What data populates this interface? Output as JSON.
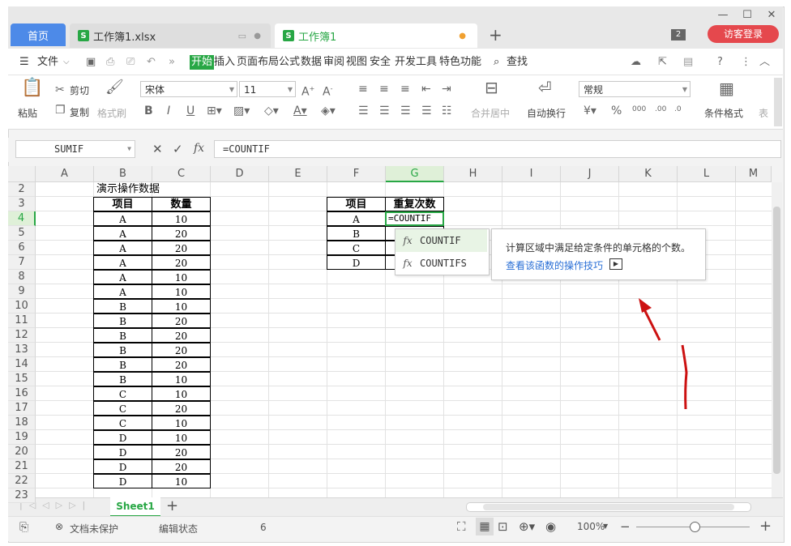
{
  "tabs": {
    "home": "首页",
    "doc1": "工作簿1.xlsx",
    "doc2": "工作簿1",
    "badge": "2",
    "login": "访客登录"
  },
  "menu": {
    "file": "文件",
    "items": [
      "开始",
      "插入",
      "页面布局",
      "公式",
      "数据",
      "审阅",
      "视图",
      "安全",
      "开发工具",
      "特色功能"
    ],
    "search": "查找"
  },
  "ribbon": {
    "paste": "粘贴",
    "cut": "剪切",
    "copy": "复制",
    "format_painter": "格式刷",
    "font_name": "宋体",
    "font_size": "11",
    "number_format": "常规",
    "merge": "合并居中",
    "wrap": "自动换行",
    "cond_format": "条件格式",
    "table": "表"
  },
  "formula_bar": {
    "name_box": "SUMIF",
    "fx": "fx",
    "formula": "=COUNTIF"
  },
  "grid": {
    "columns": [
      "A",
      "B",
      "C",
      "D",
      "E",
      "F",
      "G",
      "H",
      "I",
      "J",
      "K",
      "L",
      "M"
    ],
    "rows": [
      "2",
      "3",
      "4",
      "5",
      "6",
      "7",
      "8",
      "9",
      "10",
      "11",
      "12",
      "13",
      "14",
      "15",
      "16",
      "17",
      "18",
      "19",
      "20",
      "21",
      "22",
      "23"
    ],
    "title": "演示操作数据",
    "table1_headers": [
      "项目",
      "数量"
    ],
    "table1": [
      [
        "A",
        "10"
      ],
      [
        "A",
        "20"
      ],
      [
        "A",
        "20"
      ],
      [
        "A",
        "20"
      ],
      [
        "A",
        "10"
      ],
      [
        "A",
        "10"
      ],
      [
        "B",
        "10"
      ],
      [
        "B",
        "20"
      ],
      [
        "B",
        "20"
      ],
      [
        "B",
        "20"
      ],
      [
        "B",
        "20"
      ],
      [
        "B",
        "10"
      ],
      [
        "C",
        "10"
      ],
      [
        "C",
        "20"
      ],
      [
        "C",
        "10"
      ],
      [
        "D",
        "10"
      ],
      [
        "D",
        "20"
      ],
      [
        "D",
        "20"
      ],
      [
        "D",
        "10"
      ]
    ],
    "table2_headers": [
      "项目",
      "重复次数"
    ],
    "table2_items": [
      "A",
      "B",
      "C",
      "D"
    ],
    "editing_cell": "=COUNTIF"
  },
  "autocomplete": {
    "items": [
      "COUNTIF",
      "COUNTIFS"
    ],
    "tip_text": "计算区域中满足给定条件的单元格的个数。",
    "tip_link": "查看该函数的操作技巧"
  },
  "sheets": {
    "active": "Sheet1"
  },
  "status": {
    "protect": "文档未保护",
    "mode": "编辑状态",
    "count": "6",
    "zoom": "100%"
  },
  "colors": {
    "accent": "#28a745",
    "home_tab": "#4d8ae8",
    "annotation": "#cc1111"
  }
}
